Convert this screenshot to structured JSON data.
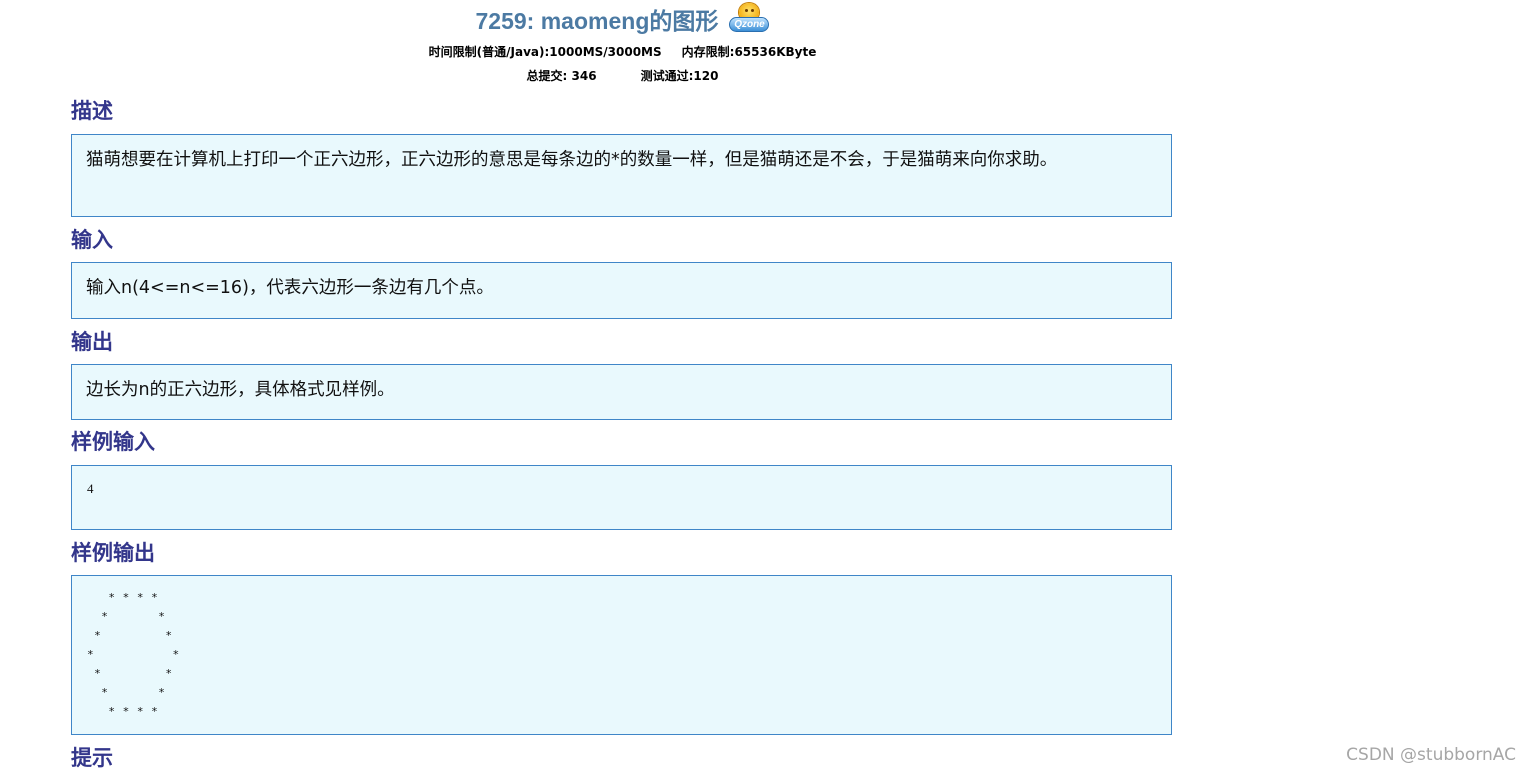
{
  "problem": {
    "title": "7259: maomeng的图形",
    "qzone_icon_text": "Qzone",
    "time_limit": "时间限制(普通/Java):1000MS/3000MS",
    "memory_limit": "内存限制:65536KByte",
    "total_submissions": "总提交: 346",
    "accepted": "测试通过:120"
  },
  "sections": {
    "description": {
      "heading": "描述",
      "text": "猫萌想要在计算机上打印一个正六边形，正六边形的意思是每条边的*的数量一样，但是猫萌还是不会，于是猫萌来向你求助。"
    },
    "input": {
      "heading": "输入",
      "text": "输入n(4<=n<=16)，代表六边形一条边有几个点。"
    },
    "output": {
      "heading": "输出",
      "text": "边长为n的正六边形，具体格式见样例。"
    },
    "sample_input": {
      "heading": "样例输入",
      "text": "4"
    },
    "sample_output": {
      "heading": "样例输出",
      "text": "   * * * *\n  *       *\n *         *\n*           *\n *         *\n  *       *\n   * * * *"
    },
    "hint": {
      "heading": "提示"
    }
  },
  "watermark": "CSDN @stubbornAC",
  "colors": {
    "title": "#4c7aa3",
    "heading": "#33368b",
    "box_background": "#e9f9fd",
    "box_border": "#3f86c8",
    "watermark": "#a6a6a6"
  }
}
